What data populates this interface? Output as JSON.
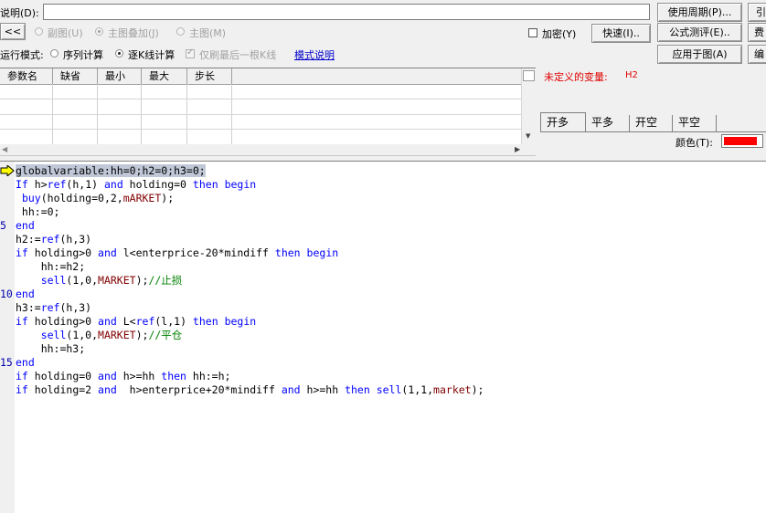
{
  "top": {
    "description_label": "说明(D):",
    "description_value": "",
    "use_period_button": "使用周期(P)...",
    "cutoff_right_top": "引"
  },
  "row2": {
    "collapse_button": "<<",
    "radio_subchart": "副图(U)",
    "radio_overlay": "主图叠加(J)",
    "radio_main": "主图(M)",
    "encrypt_label": "加密(Y)",
    "quick_button": "快速(I)..",
    "formula_test_button": "公式测评(E)..",
    "cutoff_right": "费"
  },
  "row3": {
    "run_mode_label": "运行模式:",
    "radio_sequence": "序列计算",
    "radio_per_bar": "逐K线计算",
    "refresh_last_label": "仅刷最后一根K线",
    "mode_help_link": "模式说明",
    "apply_to_chart_button": "应用于图(A)",
    "cutoff_right": "编"
  },
  "params": {
    "columns": [
      "参数名",
      "缺省",
      "最小",
      "最大",
      "步长"
    ]
  },
  "status": {
    "undefined_var_label": "未定义的变量:",
    "undefined_var_value": "H2"
  },
  "tabs": [
    "开多",
    "平多",
    "开空",
    "平空"
  ],
  "color": {
    "label": "颜色(T):",
    "value": "#ff0000"
  },
  "code_lines": [
    "globalvariable:hh=0;h2=0;h3=0;",
    "If h>ref(h,1) and holding=0 then begin",
    " buy(holding=0,2,mARKET);",
    " hh:=0;",
    "end",
    "h2:=ref(h,3)",
    "if holding>0 and l<enterprice-20*mindiff then begin",
    "    hh:=h2;",
    "    sell(1,0,MARKET);//止损",
    "end",
    "h3:=ref(h,3)",
    "if holding>0 and L<ref(l,1) then begin",
    "    sell(1,0,MARKET);//平仓",
    "    hh:=h3;",
    "end",
    "if holding=0 and h>=hh then hh:=h;",
    "if holding=2 and  h>enterprice+20*mindiff and h>=hh then sell(1,1,market);"
  ],
  "line_numbers": [
    "5",
    "10",
    "15"
  ]
}
